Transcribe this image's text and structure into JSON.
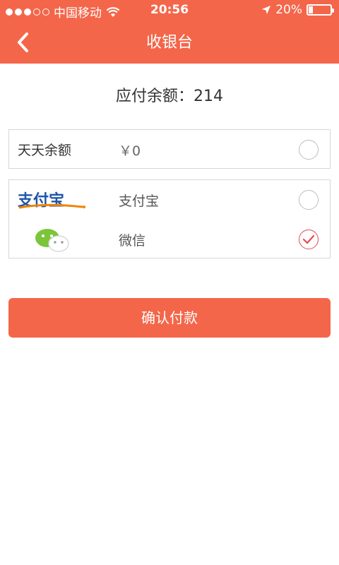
{
  "status_bar": {
    "carrier": "中国移动",
    "time": "20:56",
    "battery_text": "20%",
    "signal_bars_filled": 3,
    "signal_bars_total": 5,
    "battery_level_fraction": 0.2
  },
  "nav": {
    "title": "收银台",
    "back_icon": "chevron-left-icon"
  },
  "payment": {
    "amount_label": "应付余额：214",
    "balance_option": {
      "label": "天天余额",
      "value": "￥0",
      "checked": false
    },
    "methods": [
      {
        "name": "支付宝",
        "logo_text": "支付宝",
        "icon": "alipay-logo",
        "checked": false
      },
      {
        "name": "微信",
        "icon": "wechat-logo",
        "checked": true
      }
    ],
    "confirm_label": "确认付款"
  },
  "colors": {
    "accent": "#f4664a",
    "check": "#e44c4c",
    "alipay_blue": "#1f56a8",
    "alipay_orange": "#f08300",
    "wechat_green": "#7cc53a"
  }
}
